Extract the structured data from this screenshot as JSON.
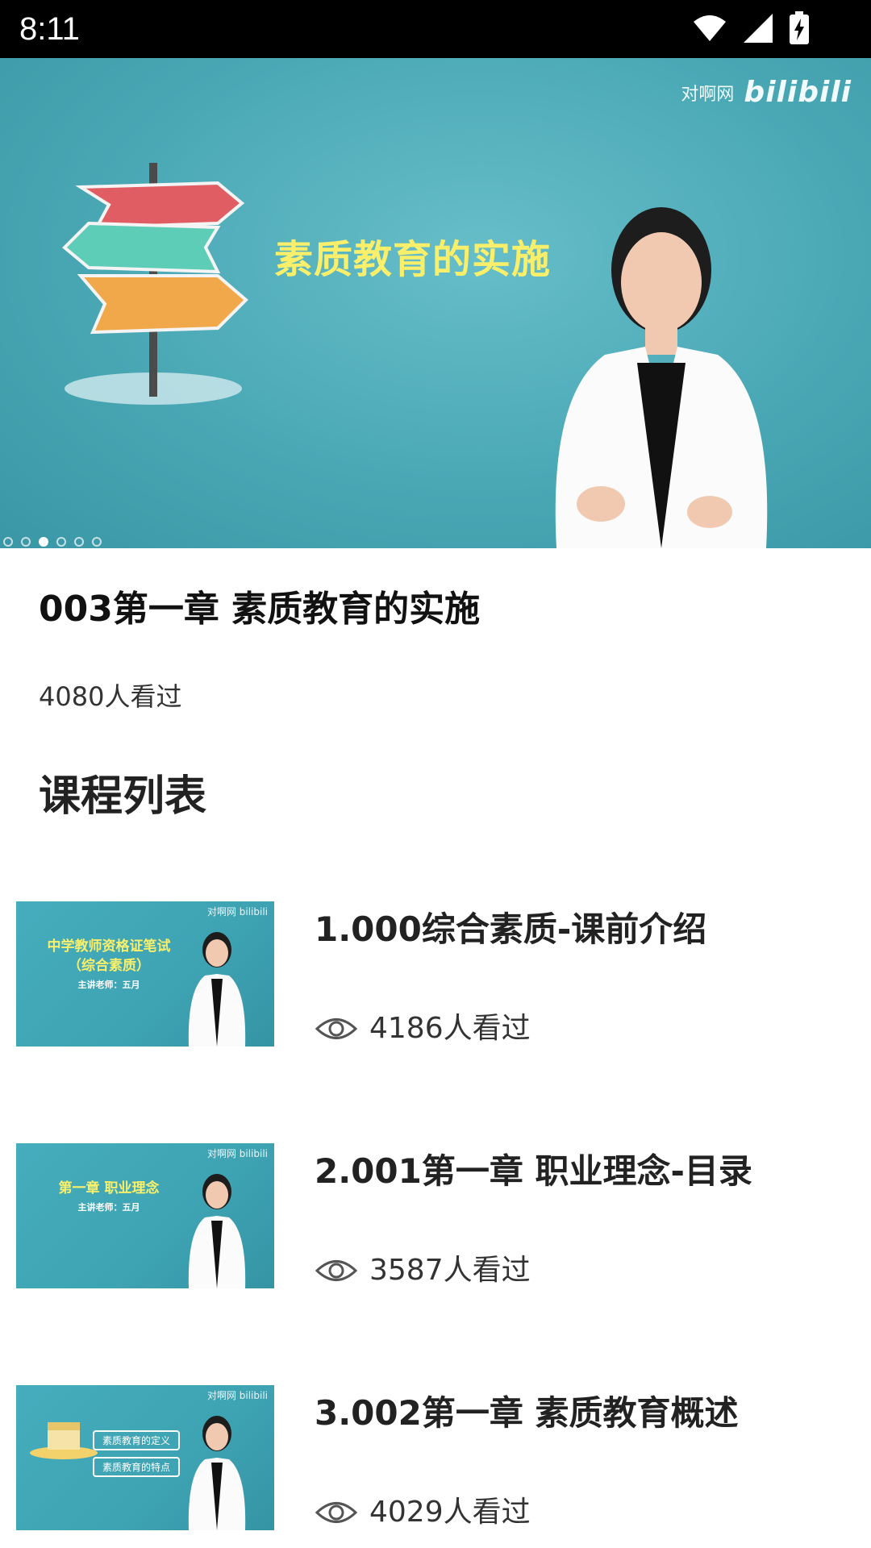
{
  "status_bar": {
    "time": "8:11"
  },
  "video": {
    "watermark_text": "对啊网",
    "watermark_logo": "bilibili",
    "heading": "素质教育的实施"
  },
  "main": {
    "title": "003第一章 素质教育的实施",
    "views": "4080人看过",
    "section_title": "课程列表"
  },
  "courses": [
    {
      "title": "1.000综合素质-课前介绍",
      "views": "4186人看过",
      "thumb_line1": "中学教师资格证笔试",
      "thumb_line2": "（综合素质）",
      "thumb_line3": "主讲老师：五月"
    },
    {
      "title": "2.001第一章 职业理念-目录",
      "views": "3587人看过",
      "thumb_line1": "第一章  职业理念",
      "thumb_line2": "",
      "thumb_line3": "主讲老师：五月"
    },
    {
      "title": "3.002第一章 素质教育概述",
      "views": "4029人看过",
      "thumb_line1": "素质教育的定义",
      "thumb_line2": "",
      "thumb_line3": "素质教育的特点"
    }
  ],
  "thumb_logo": "对啊网 bilibili",
  "colors": {
    "accent_yellow": "#f9ef6a",
    "video_teal": "#4aa8b5"
  }
}
